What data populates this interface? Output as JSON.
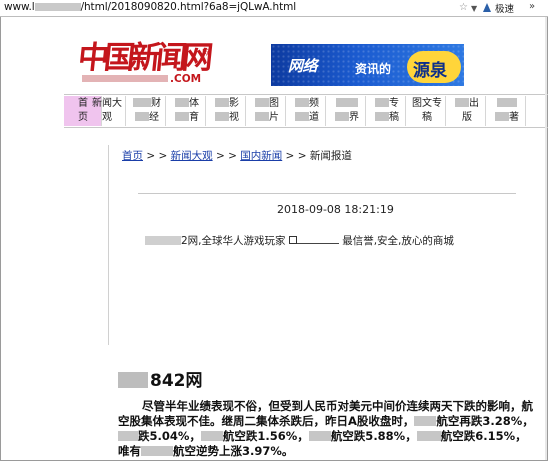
{
  "address_bar": {
    "url_prefix": "www.l",
    "url_suffix": "/html/2018090820.html?6a8=jQLwA.html",
    "speed_label": "极速",
    "more_label": "»"
  },
  "logo": {
    "text": "中国新闻网",
    "side": "网",
    "domain": ".COM"
  },
  "banner": {
    "part1": "网络",
    "part2": "资讯的",
    "part3": "源泉"
  },
  "nav": [
    {
      "l1": "首",
      "l2": "页"
    },
    {
      "l1": "新闻大",
      "l2": "观"
    },
    {
      "l1": "财",
      "l2": "经"
    },
    {
      "l1": "体",
      "l2": "育"
    },
    {
      "l1": "影",
      "l2": "视"
    },
    {
      "l1": "图",
      "l2": "片"
    },
    {
      "l1": "频",
      "l2": "道"
    },
    {
      "l1": "世",
      "l2": "界"
    },
    {
      "l1": "专",
      "l2": "稿"
    },
    {
      "l1": "图文专",
      "l2": "稿"
    },
    {
      "l1": "出",
      "l2": "版"
    },
    {
      "l1": "",
      "l2": "著"
    }
  ],
  "breadcrumb": {
    "home": "首页",
    "sep": " > > ",
    "cat1": "新闻大观",
    "cat2": "国内新闻",
    "current": "新闻报道"
  },
  "article": {
    "datetime": "2018-09-08 18:21:19",
    "ad_text_a": "2网,全球华人游戏玩家",
    "ad_text_b": "最信誉,安全,放心的商城",
    "headline": "842网",
    "para_1": "尽管半年业绩表现不俗，但受到人民币对美元中间价连续两天下跌的影响，航空股集体表现不佳。继周二集体杀跌后，昨日A股收盘时，",
    "para_2": "航空再跌3.28%，",
    "para_3": "跌5.04%，",
    "para_4": "航空跌1.56%，",
    "para_5": "航空跌5.88%，",
    "para_6": "航空跌6.15%，唯有",
    "para_7": "航空逆势上涨3.97%。"
  }
}
